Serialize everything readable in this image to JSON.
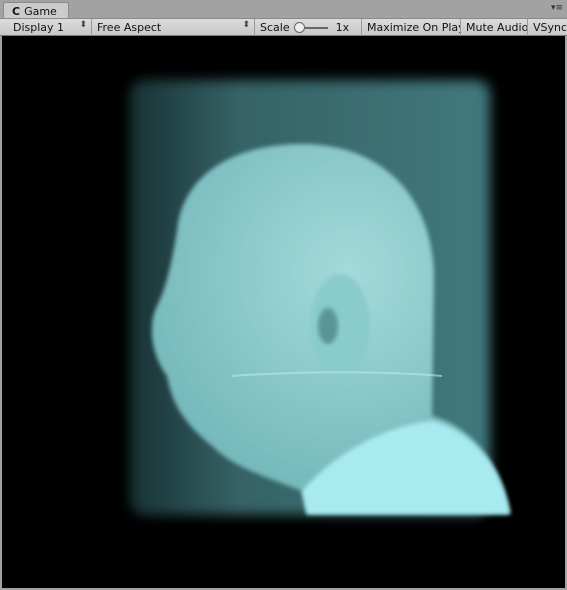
{
  "tab": {
    "title": "Game",
    "icon": "pacman-game-icon"
  },
  "toolbar": {
    "display": "Display 1",
    "aspect": "Free Aspect",
    "scale_label": "Scale",
    "scale_value": "1x",
    "maximize": "Maximize On Play",
    "mute": "Mute Audio",
    "vsync": "VSync"
  },
  "colors": {
    "volume_tint": "#8fe0e6",
    "background": "#000000"
  }
}
